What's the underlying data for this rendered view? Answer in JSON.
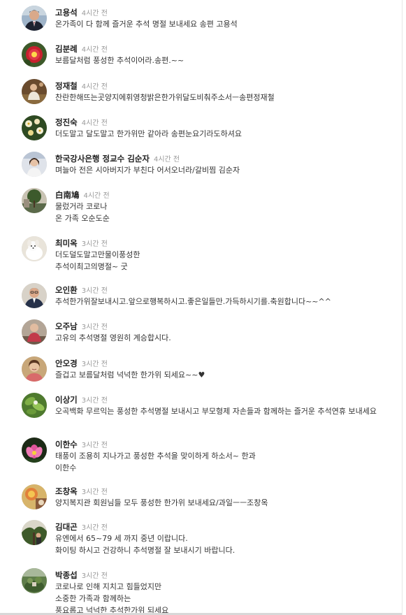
{
  "comments": [
    {
      "name": "고용석",
      "time": "4시간 전",
      "text": "온가족이 다 함께 즐거운 추석 명절 보내세요 송편 고용석",
      "avatar": "avatar-man-suit"
    },
    {
      "name": "김분례",
      "time": "4시간 전",
      "text": "보름달처럼 풍성한 추석이어라.송편.~~",
      "avatar": "avatar-red-flower"
    },
    {
      "name": "정재철",
      "time": "4시간 전",
      "text": "찬란한해뜨는곳양지에휘영청밝은한가위달도비춰주소서ㅡ송편정재철",
      "avatar": "avatar-person-outdoor"
    },
    {
      "name": "정진숙",
      "time": "4시간 전",
      "text": "더도말고 달도말고 한가위만 같아라 송편눈요기라도하셔요",
      "avatar": "avatar-flowers"
    },
    {
      "name": "한국강사은행 정교수 김순자",
      "time": "4시간 전",
      "text": "며늘아 전은 시아버지가 부친다 어서오너라/갈비찜 김순자",
      "avatar": "avatar-woman-portrait"
    },
    {
      "name": "白南鳩",
      "time": "4시간 전",
      "text": "물렀거라 코로나\n온 가족 오순도순",
      "avatar": "avatar-tree-building"
    },
    {
      "name": "최미옥",
      "time": "3시간 전",
      "text": "더도덜도말고만물이풍성한\n추석이최고의명절~ 굿",
      "avatar": "avatar-white-dog"
    },
    {
      "name": "오인환",
      "time": "3시간 전",
      "text": "추석한가위잘보내시고.앞으로행복하시고.좋은일들만.가득하시기를.축원합니다~~^^",
      "avatar": "avatar-man-glasses"
    },
    {
      "name": "오주남",
      "time": "3시간 전",
      "text": "고유의 추석명절 영원히 계승합시다.",
      "avatar": "avatar-woman-sitting"
    },
    {
      "name": "안오경",
      "time": "3시간 전",
      "text": "즐겁고 보름달처럼 넉넉한 한가위 되세요~~♥",
      "avatar": "avatar-woman-smiling"
    },
    {
      "name": "이상기",
      "time": "3시간 전",
      "text": "오곡백화 무르익는 풍성한 추석명절 보내시고 부모형제 자손들과 함께하는 즐거운 추석연휴 보내세요",
      "avatar": "avatar-green-leaves"
    },
    {
      "name": "이한수",
      "time": "3시간 전",
      "text": "태풍이 조용히 지나가고 풍성한 추석을 맞이하게 하소서~ 한과\n이한수",
      "avatar": "avatar-pink-lotus"
    },
    {
      "name": "조창옥",
      "time": "3시간 전",
      "text": "양지복지관 회원님들 모두 풍성한 한가위 보내세요/과일ㅡㅡ조창옥",
      "avatar": "avatar-orange-art"
    },
    {
      "name": "김대곤",
      "time": "3시간 전",
      "text": "유엔에서 65~79 세 까지 중년 이랍니다.\n화이팅 하시고 건강하니 추석명절 잘 보내시기 바랍니다.",
      "avatar": "avatar-person-tree"
    },
    {
      "name": "박종섭",
      "time": "3시간 전",
      "text": "코로나로 인해 지치고 힘들었지만\n소중한 가족과 함께하는\n풍요롭고 넉넉한 추석한가위 되세요",
      "avatar": "avatar-garden"
    }
  ]
}
